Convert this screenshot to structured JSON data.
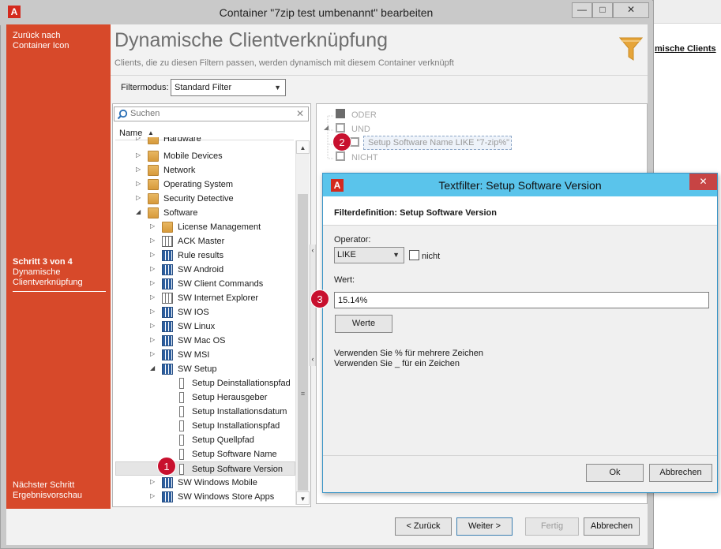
{
  "background_app": {
    "link_text": "mische Clients"
  },
  "window": {
    "title": "Container \"7zip test umbenannt\" bearbeiten",
    "app_icon": "A",
    "minimize": "—",
    "maximize": "□",
    "close": "✕"
  },
  "sidebar": {
    "back_line1": "Zurück nach",
    "back_line2": "Container Icon",
    "step_title": "Schritt 3 von 4",
    "step_line1": "Dynamische",
    "step_line2": "Clientverknüpfung",
    "next_line1": "Nächster Schritt",
    "next_line2": "Ergebnisvorschau"
  },
  "header": {
    "title": "Dynamische Clientverknüpfung",
    "subtitle": "Clients, die zu diesen Filtern passen, werden dynamisch mit diesem Container verknüpft",
    "filter_icon": "funnel-icon"
  },
  "filtermode": {
    "label": "Filtermodus:",
    "value": "Standard Filter"
  },
  "search": {
    "placeholder": "Suchen",
    "clear": "✕"
  },
  "tree": {
    "column_header": "Name",
    "rows": [
      {
        "label": "Hardware",
        "icon": "folder"
      },
      {
        "label": "Mobile Devices",
        "icon": "folder"
      },
      {
        "label": "Network",
        "icon": "folder"
      },
      {
        "label": "Operating System",
        "icon": "folder"
      },
      {
        "label": "Security Detective",
        "icon": "folder"
      },
      {
        "label": "Software",
        "icon": "folder"
      },
      {
        "label": "License Management",
        "icon": "folder"
      },
      {
        "label": "ACK Master",
        "icon": "table-light"
      },
      {
        "label": "Rule results",
        "icon": "table-dark"
      },
      {
        "label": "SW Android",
        "icon": "table-dark"
      },
      {
        "label": "SW Client Commands",
        "icon": "table-dark"
      },
      {
        "label": "SW Internet Explorer",
        "icon": "table-light"
      },
      {
        "label": "SW IOS",
        "icon": "table-dark"
      },
      {
        "label": "SW Linux",
        "icon": "table-dark"
      },
      {
        "label": "SW Mac OS",
        "icon": "table-dark"
      },
      {
        "label": "SW MSI",
        "icon": "table-dark"
      },
      {
        "label": "SW Setup",
        "icon": "table-dark"
      },
      {
        "label": "Setup Deinstallationspfad",
        "icon": "field"
      },
      {
        "label": "Setup Herausgeber",
        "icon": "field"
      },
      {
        "label": "Setup Installationsdatum",
        "icon": "field"
      },
      {
        "label": "Setup Installationspfad",
        "icon": "field"
      },
      {
        "label": "Setup Quellpfad",
        "icon": "field"
      },
      {
        "label": "Setup Software Name",
        "icon": "field"
      },
      {
        "label": "Setup Software Version",
        "icon": "field",
        "selected": true
      },
      {
        "label": "SW Windows Mobile",
        "icon": "table-dark"
      },
      {
        "label": "SW Windows Store Apps",
        "icon": "table-dark"
      }
    ]
  },
  "filter_tree": {
    "or_label": "ODER",
    "and_label": "UND",
    "expression": "Setup Software Name LIKE \"7-zip%\"",
    "not_label": "NICHT"
  },
  "markers": {
    "m1": "1",
    "m2": "2",
    "m3": "3"
  },
  "wizard_buttons": {
    "back": "< Zurück",
    "next": "Weiter >",
    "finish": "Fertig",
    "cancel": "Abbrechen"
  },
  "dialog": {
    "title": "Textfilter: Setup Software Version",
    "app_icon": "A",
    "close": "✕",
    "definition": "Filterdefinition: Setup Software Version",
    "operator_label": "Operator:",
    "operator_value": "LIKE",
    "not_label": "nicht",
    "value_label": "Wert:",
    "value": "15.14%",
    "values_button": "Werte",
    "hint1": "Verwenden Sie % für mehrere Zeichen",
    "hint2": "Verwenden Sie _ für ein Zeichen",
    "ok": "Ok",
    "cancel": "Abbrechen"
  },
  "colors": {
    "sidebar": "#d7492a",
    "dialog_title": "#5ac4eb",
    "marker": "#c8102e",
    "funnel": "#e6a53a"
  }
}
